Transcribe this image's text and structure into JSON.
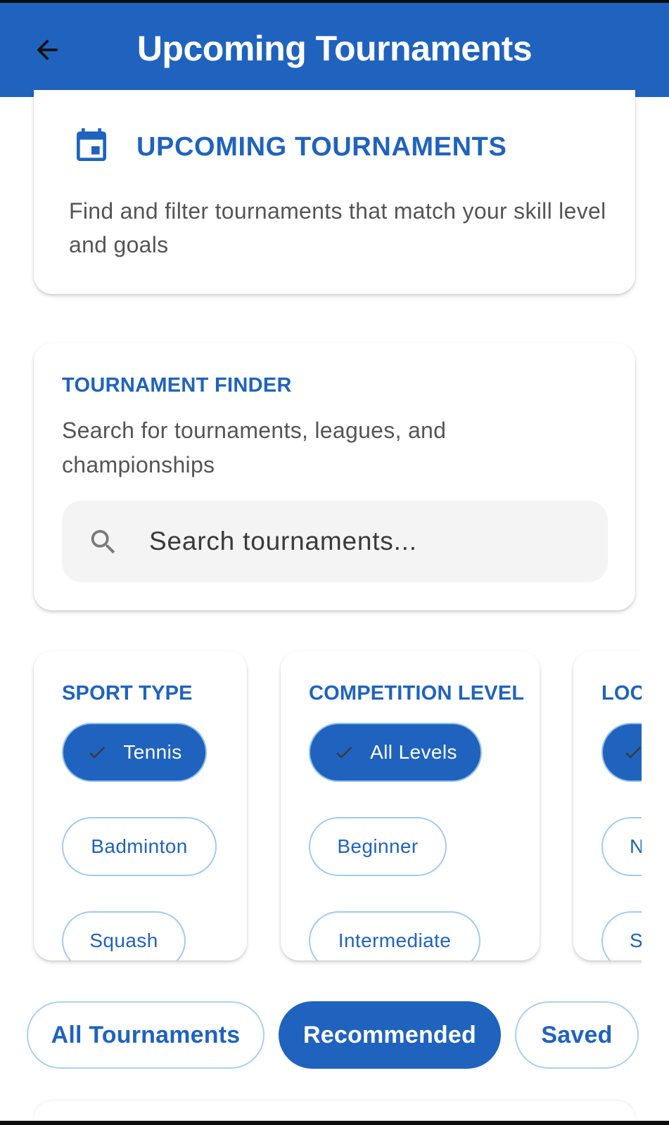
{
  "appbar": {
    "title": "Upcoming Tournaments",
    "back_icon": "arrow-left-icon",
    "color": "#1f63be"
  },
  "hero": {
    "icon": "calendar-icon",
    "title": "UPCOMING TOURNAMENTS",
    "description": "Find and filter tournaments that match your skill level and goals"
  },
  "finder": {
    "title": "TOURNAMENT FINDER",
    "description": "Search for tournaments, leagues, and championships",
    "search": {
      "icon": "search-icon",
      "placeholder": "Search tournaments...",
      "value": ""
    }
  },
  "filters": {
    "sport": {
      "title": "SPORT TYPE",
      "options": [
        {
          "label": "Tennis",
          "selected": true
        },
        {
          "label": "Badminton",
          "selected": false
        },
        {
          "label": "Squash",
          "selected": false
        }
      ]
    },
    "level": {
      "title": "COMPETITION LEVEL",
      "options": [
        {
          "label": "All Levels",
          "selected": true
        },
        {
          "label": "Beginner",
          "selected": false
        },
        {
          "label": "Intermediate",
          "selected": false
        }
      ]
    },
    "location": {
      "title": "LOCA",
      "options": [
        {
          "label": "",
          "selected": true
        },
        {
          "label": "N",
          "selected": false
        },
        {
          "label": "S",
          "selected": false
        }
      ]
    }
  },
  "tabs": [
    {
      "label": "All Tournaments",
      "active": false
    },
    {
      "label": "Recommended",
      "active": true
    },
    {
      "label": "Saved",
      "active": false
    }
  ],
  "colors": {
    "primary": "#1f63be",
    "chip_border": "#9fcbf0",
    "text_muted": "#555555",
    "search_bg": "#f4f4f4"
  }
}
